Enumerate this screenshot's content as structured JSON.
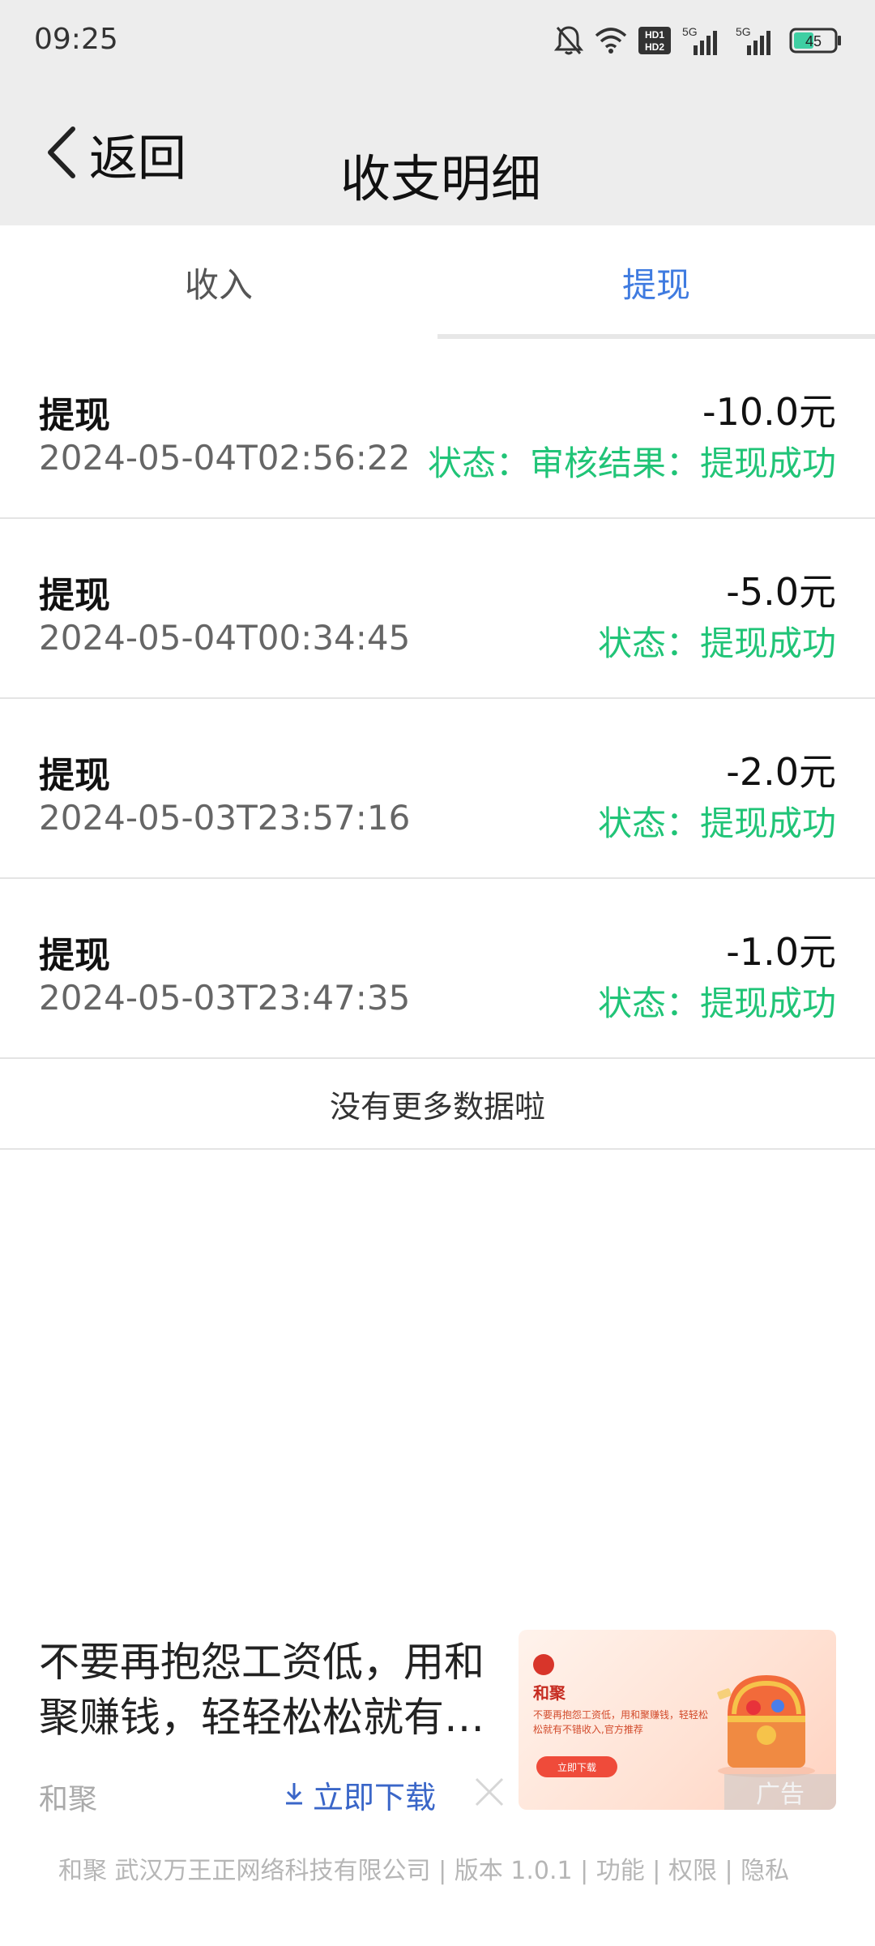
{
  "status_bar": {
    "time": "09:25",
    "icons": [
      "bell-off-icon",
      "wifi-icon",
      "hd-icon",
      "signal-5g-icon",
      "signal-5g-icon",
      "battery-icon"
    ],
    "hd_label_top": "HD1",
    "hd_label_bottom": "HD2",
    "network_label": "5G",
    "battery_level": "45"
  },
  "header": {
    "back_label": "返回",
    "title": "收支明细"
  },
  "tabs": [
    {
      "label": "收入",
      "active": false
    },
    {
      "label": "提现",
      "active": true
    }
  ],
  "records": [
    {
      "title": "提现",
      "time": "2024-05-04T02:56:22",
      "amount": "-10.0元",
      "status": "状态：审核结果：提现成功"
    },
    {
      "title": "提现",
      "time": "2024-05-04T00:34:45",
      "amount": "-5.0元",
      "status": "状态：提现成功"
    },
    {
      "title": "提现",
      "time": "2024-05-03T23:57:16",
      "amount": "-2.0元",
      "status": "状态：提现成功"
    },
    {
      "title": "提现",
      "time": "2024-05-03T23:47:35",
      "amount": "-1.0元",
      "status": "状态：提现成功"
    }
  ],
  "no_more": "没有更多数据啦",
  "ad": {
    "text": "不要再抱怨工资低，用和聚赚钱，轻轻松松就有…",
    "brand": "和聚",
    "download_label": "立即下载",
    "image": {
      "brand": "和聚",
      "text": "不要再抱怨工资低，用和聚赚钱，轻轻松松就有不错收入,官方推荐",
      "button": "立即下载",
      "badge": "广告"
    }
  },
  "footer": "和聚 武汉万王正网络科技有限公司 | 版本 1.0.1 | 功能 | 权限 | 隐私",
  "colors": {
    "accent": "#3f7be0",
    "success": "#20c477",
    "header_bg": "#ededed"
  }
}
